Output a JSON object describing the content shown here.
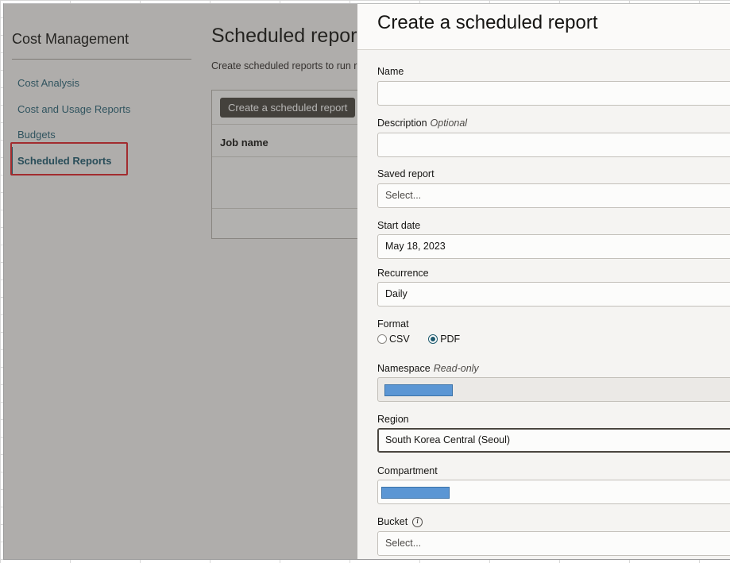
{
  "sidebar": {
    "title": "Cost Management",
    "items": [
      {
        "label": "Cost Analysis"
      },
      {
        "label": "Cost and Usage Reports"
      },
      {
        "label": "Budgets"
      },
      {
        "label": "Scheduled Reports"
      }
    ]
  },
  "main": {
    "title": "Scheduled repor",
    "description": "Create scheduled reports to run r",
    "create_button": "Create a scheduled report",
    "column_header": "Job name"
  },
  "drawer": {
    "title": "Create a scheduled report",
    "name": {
      "label": "Name",
      "value": ""
    },
    "description": {
      "label": "Description",
      "optional": "Optional",
      "value": ""
    },
    "saved_report": {
      "label": "Saved report",
      "placeholder": "Select..."
    },
    "start_date": {
      "label": "Start date",
      "value": "May 18, 2023"
    },
    "recurrence": {
      "label": "Recurrence",
      "value": "Daily"
    },
    "format": {
      "label": "Format",
      "options": [
        "CSV",
        "PDF"
      ],
      "selected": "PDF"
    },
    "namespace": {
      "label": "Namespace",
      "note": "Read-only"
    },
    "region": {
      "label": "Region",
      "value": "South Korea Central (Seoul)"
    },
    "compartment": {
      "label": "Compartment"
    },
    "bucket": {
      "label": "Bucket",
      "placeholder": "Select..."
    }
  },
  "colors": {
    "accent": "#2a6478",
    "highlight": "#e0242b",
    "redaction": "#5b96d4",
    "button": "#4a4640"
  }
}
